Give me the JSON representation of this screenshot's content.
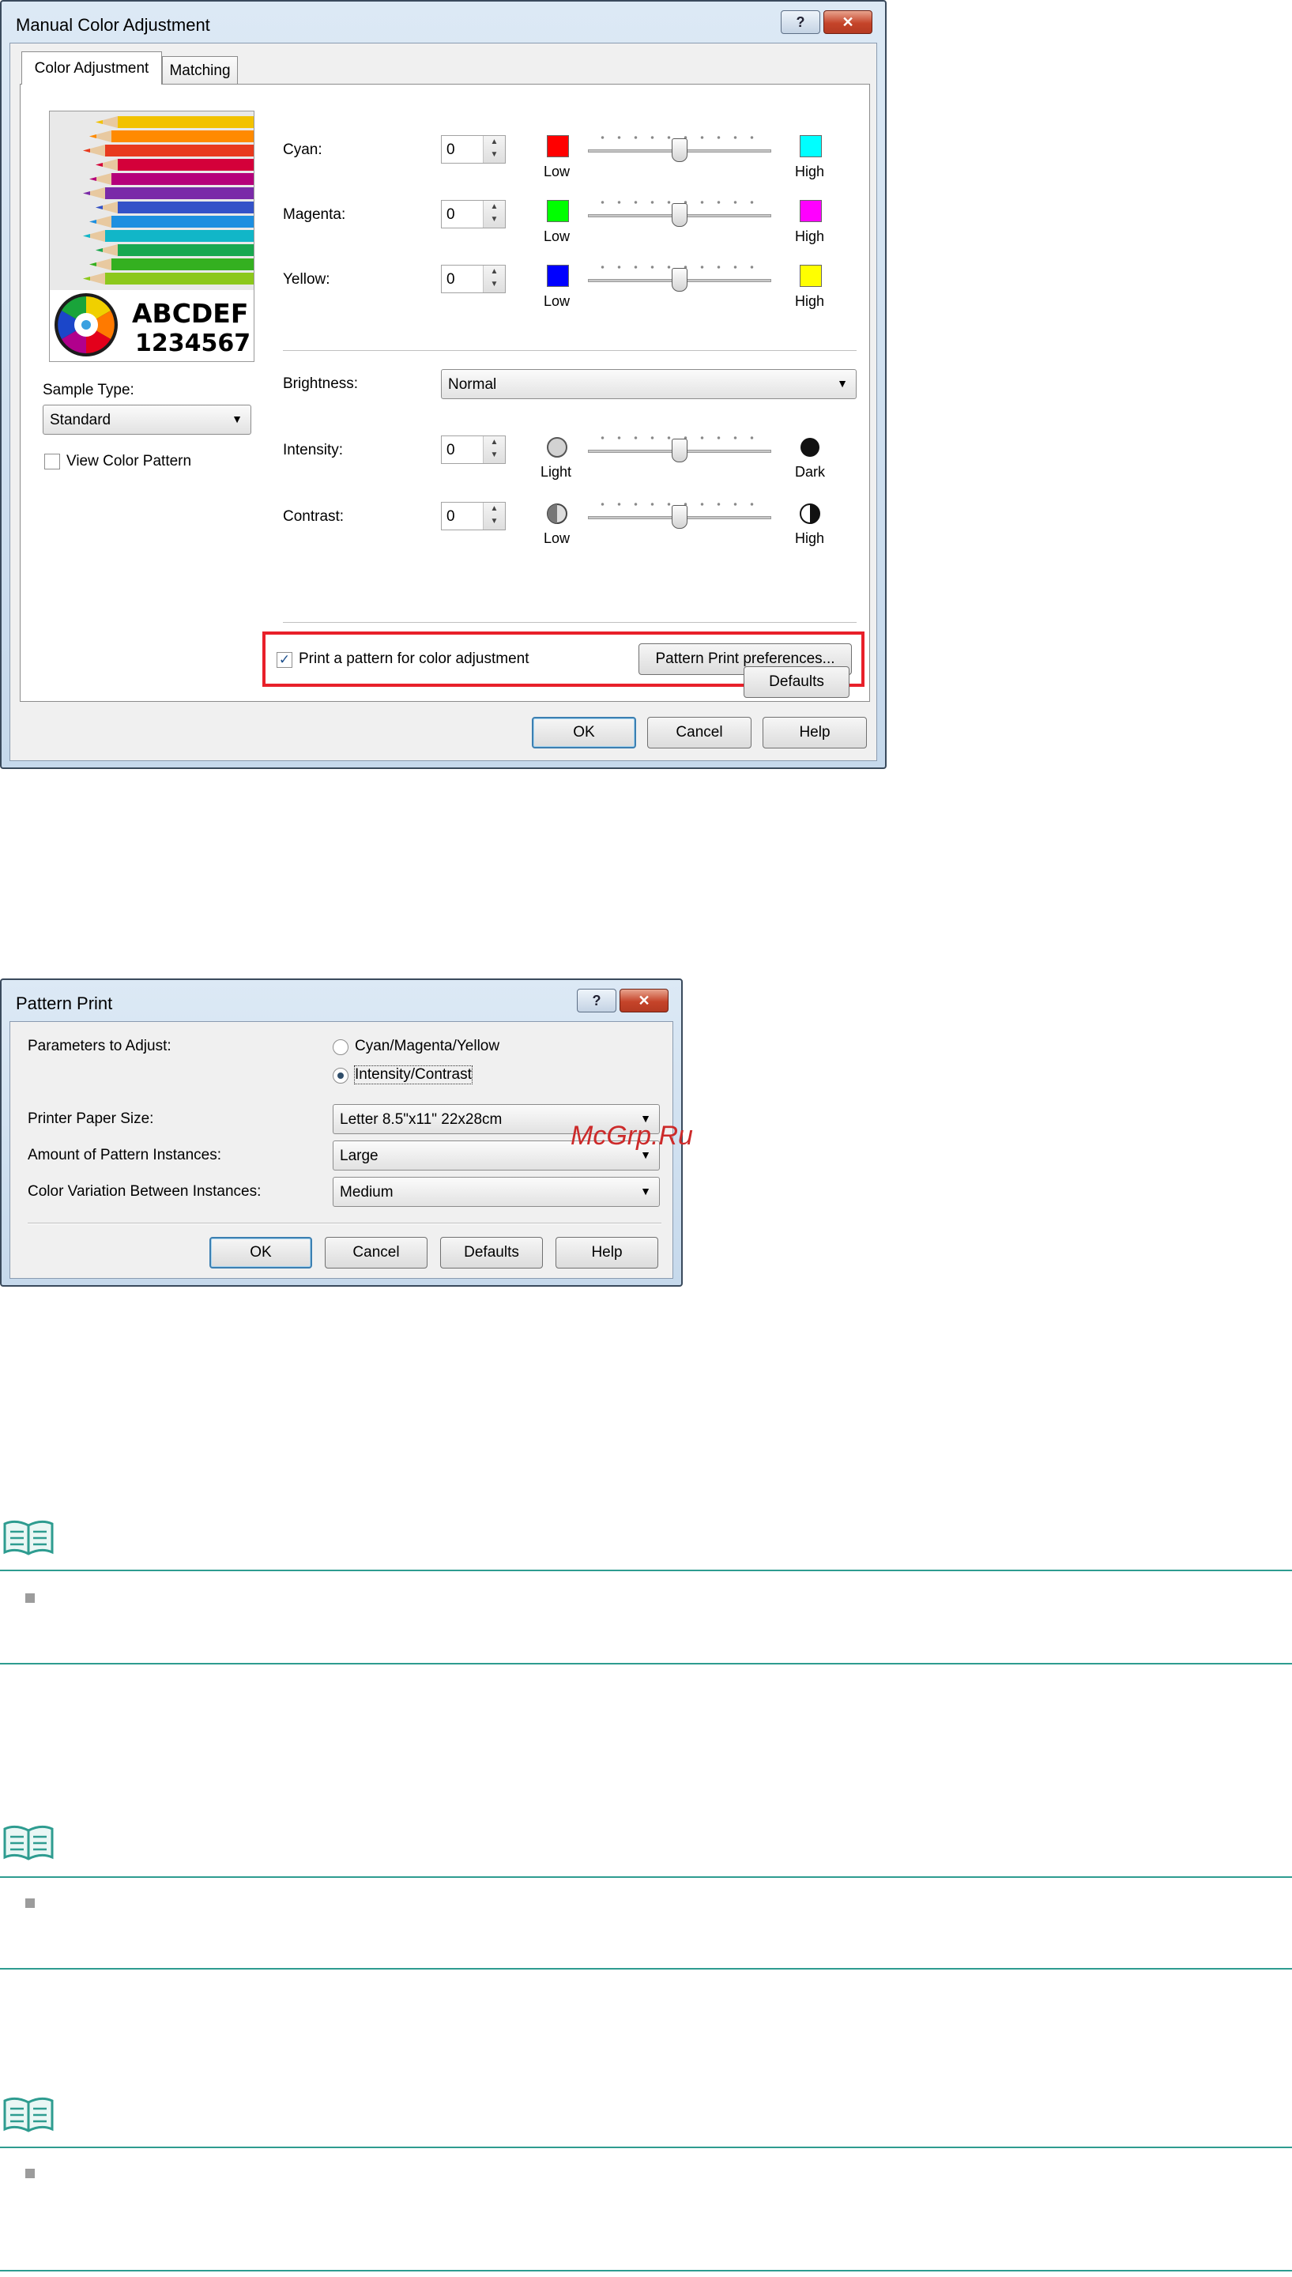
{
  "manual_dialog": {
    "title": "Manual Color Adjustment",
    "help_caption": "?",
    "close_caption": "✕",
    "tabs": [
      {
        "label": "Color Adjustment",
        "active": true
      },
      {
        "label": "Matching",
        "active": false
      }
    ],
    "sample_text_line1": "ABCDEF",
    "sample_text_line2": "1234567",
    "sample_type_label": "Sample Type:",
    "sample_type_value": "Standard",
    "view_color_pattern_label": "View Color Pattern",
    "view_color_pattern_checked": false,
    "sliders": [
      {
        "label": "Cyan:",
        "value": "0",
        "low_label": "Low",
        "high_label": "High",
        "low_color": "#ff0000",
        "high_color": "#00ffff",
        "level": 0.5
      },
      {
        "label": "Magenta:",
        "value": "0",
        "low_label": "Low",
        "high_label": "High",
        "low_color": "#00ff00",
        "high_color": "#ff00ff",
        "level": 0.5
      },
      {
        "label": "Yellow:",
        "value": "0",
        "low_label": "Low",
        "high_label": "High",
        "low_color": "#0000ff",
        "high_color": "#ffff00",
        "level": 0.5
      }
    ],
    "brightness_label": "Brightness:",
    "brightness_value": "Normal",
    "intensity": {
      "label": "Intensity:",
      "value": "0",
      "low_label": "Light",
      "high_label": "Dark",
      "level": 0.5
    },
    "contrast": {
      "label": "Contrast:",
      "value": "0",
      "low_label": "Low",
      "high_label": "High",
      "level": 0.5
    },
    "print_pattern_label": "Print a pattern for color adjustment",
    "print_pattern_checked": true,
    "pattern_prefs_button": "Pattern Print preferences...",
    "defaults_button": "Defaults",
    "ok_button": "OK",
    "cancel_button": "Cancel",
    "help_button": "Help"
  },
  "pattern_dialog": {
    "title": "Pattern Print",
    "help_caption": "?",
    "close_caption": "✕",
    "params_label": "Parameters to Adjust:",
    "radio_cmy": "Cyan/Magenta/Yellow",
    "radio_ic": "Intensity/Contrast",
    "selected_param": "Intensity/Contrast",
    "paper_size_label": "Printer Paper Size:",
    "paper_size_value": "Letter 8.5\"x11\" 22x28cm",
    "amount_label": "Amount of Pattern Instances:",
    "amount_value": "Large",
    "variation_label": "Color Variation Between Instances:",
    "variation_value": "Medium",
    "ok_button": "OK",
    "cancel_button": "Cancel",
    "defaults_button": "Defaults",
    "help_button": "Help"
  },
  "watermark": "McGrp.Ru",
  "colors": {
    "highlight_box": "#e8202a",
    "note_rule": "#2e9c90"
  }
}
